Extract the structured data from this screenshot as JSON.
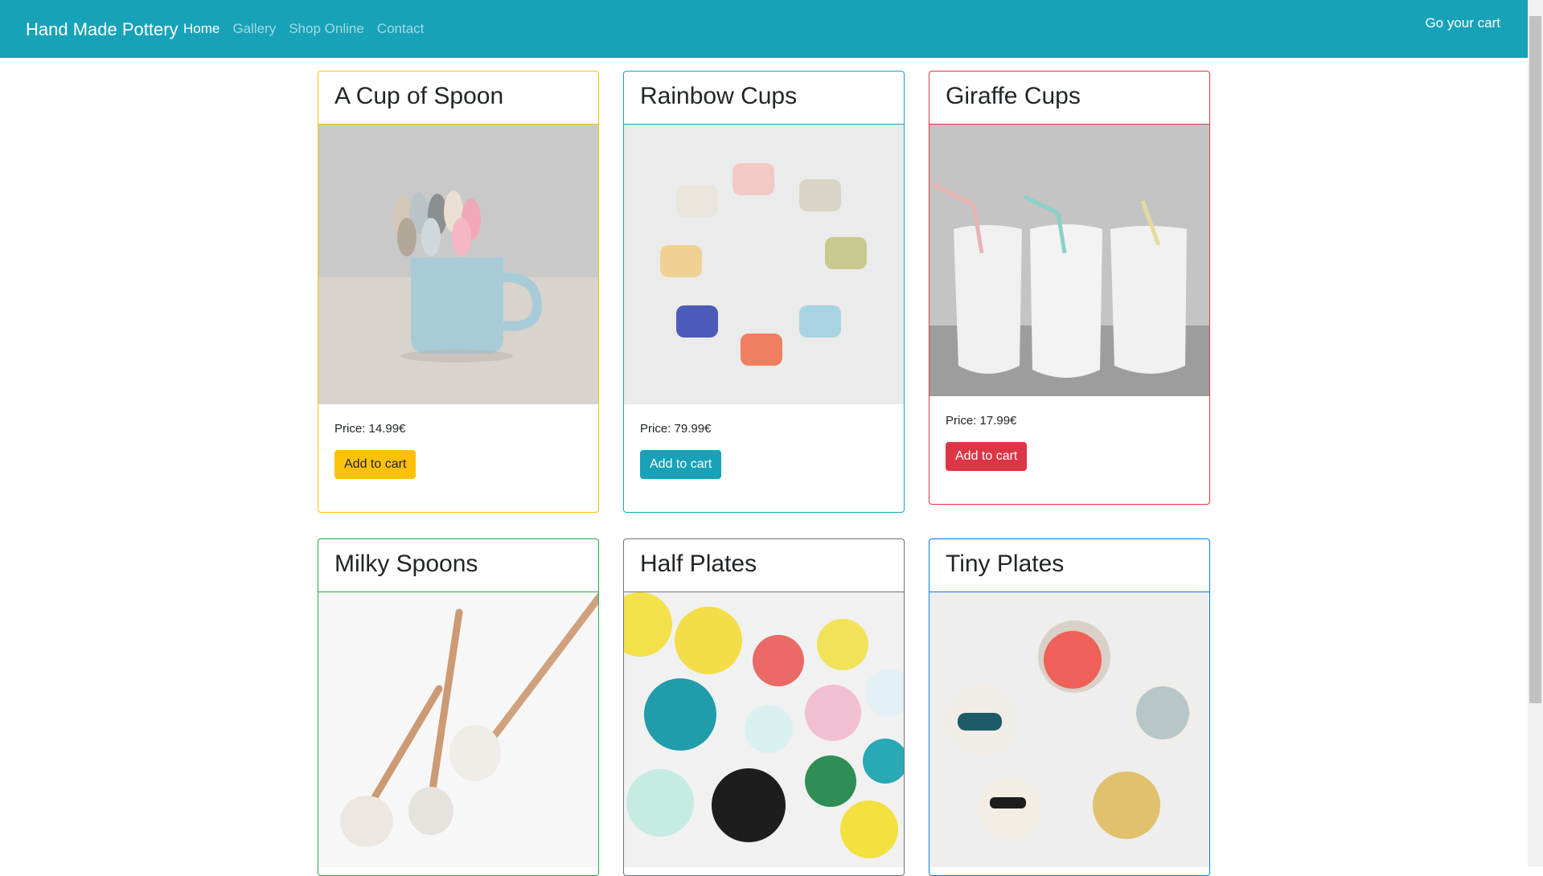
{
  "navbar": {
    "brand": "Hand Made Pottery",
    "links": [
      {
        "label": "Home",
        "active": true
      },
      {
        "label": "Gallery",
        "active": false
      },
      {
        "label": "Shop Online",
        "active": false
      },
      {
        "label": "Contact",
        "active": false
      }
    ],
    "cart_label": "Go your cart",
    "bg_color": "#17a2b8"
  },
  "products": [
    {
      "title": "A Cup of Spoon",
      "price": "Price: 14.99€",
      "button": "Add to cart",
      "accent": "#ffc107"
    },
    {
      "title": "Rainbow Cups",
      "price": "Price: 79.99€",
      "button": "Add to cart",
      "accent": "#17a2b8"
    },
    {
      "title": "Giraffe Cups",
      "price": "Price: 17.99€",
      "button": "Add to cart",
      "accent": "#dc3545"
    },
    {
      "title": "Milky Spoons",
      "accent": "#28a745"
    },
    {
      "title": "Half Plates",
      "accent": "#6c757d"
    },
    {
      "title": "Tiny Plates",
      "accent": "#007bff"
    }
  ]
}
